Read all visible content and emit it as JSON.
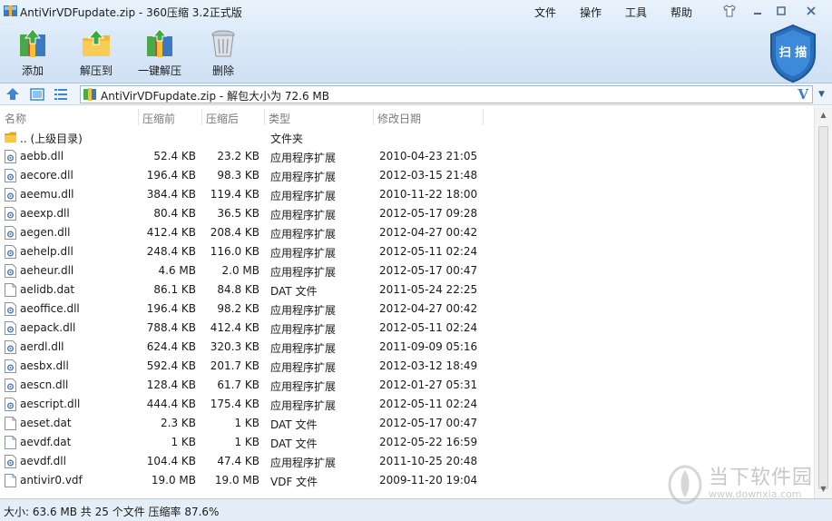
{
  "window": {
    "title": "AntiVirVDFupdate.zip - 360压缩 3.2正式版"
  },
  "menu": {
    "items": [
      "文件",
      "操作",
      "工具",
      "帮助"
    ]
  },
  "toolbar": {
    "add_label": "添加",
    "extract_label": "解压到",
    "oneclick_label": "一键解压",
    "delete_label": "删除"
  },
  "scan": {
    "label": "扫 描"
  },
  "address": {
    "path": "AntiVirVDFupdate.zip - 解包大小为 72.6 MB",
    "logo": "V"
  },
  "columns": {
    "name": "名称",
    "size": "压缩前",
    "packed": "压缩后",
    "type": "类型",
    "date": "修改日期"
  },
  "files": [
    {
      "icon": "folder-up-icon",
      "name": ".. (上级目录)",
      "size": "",
      "packed": "",
      "type": "文件夹",
      "date": ""
    },
    {
      "icon": "dll-icon",
      "name": "aebb.dll",
      "size": "52.4 KB",
      "packed": "23.2 KB",
      "type": "应用程序扩展",
      "date": "2010-04-23 21:05"
    },
    {
      "icon": "dll-icon",
      "name": "aecore.dll",
      "size": "196.4 KB",
      "packed": "98.3 KB",
      "type": "应用程序扩展",
      "date": "2012-03-15 21:48"
    },
    {
      "icon": "dll-icon",
      "name": "aeemu.dll",
      "size": "384.4 KB",
      "packed": "119.4 KB",
      "type": "应用程序扩展",
      "date": "2010-11-22 18:00"
    },
    {
      "icon": "dll-icon",
      "name": "aeexp.dll",
      "size": "80.4 KB",
      "packed": "36.5 KB",
      "type": "应用程序扩展",
      "date": "2012-05-17 09:28"
    },
    {
      "icon": "dll-icon",
      "name": "aegen.dll",
      "size": "412.4 KB",
      "packed": "208.4 KB",
      "type": "应用程序扩展",
      "date": "2012-04-27 00:42"
    },
    {
      "icon": "dll-icon",
      "name": "aehelp.dll",
      "size": "248.4 KB",
      "packed": "116.0 KB",
      "type": "应用程序扩展",
      "date": "2012-05-11 02:24"
    },
    {
      "icon": "dll-icon",
      "name": "aeheur.dll",
      "size": "4.6 MB",
      "packed": "2.0 MB",
      "type": "应用程序扩展",
      "date": "2012-05-17 00:47"
    },
    {
      "icon": "file-icon",
      "name": "aelidb.dat",
      "size": "86.1 KB",
      "packed": "84.8 KB",
      "type": "DAT 文件",
      "date": "2011-05-24 22:25"
    },
    {
      "icon": "dll-icon",
      "name": "aeoffice.dll",
      "size": "196.4 KB",
      "packed": "98.2 KB",
      "type": "应用程序扩展",
      "date": "2012-04-27 00:42"
    },
    {
      "icon": "dll-icon",
      "name": "aepack.dll",
      "size": "788.4 KB",
      "packed": "412.4 KB",
      "type": "应用程序扩展",
      "date": "2012-05-11 02:24"
    },
    {
      "icon": "dll-icon",
      "name": "aerdl.dll",
      "size": "624.4 KB",
      "packed": "320.3 KB",
      "type": "应用程序扩展",
      "date": "2011-09-09 05:16"
    },
    {
      "icon": "dll-icon",
      "name": "aesbx.dll",
      "size": "592.4 KB",
      "packed": "201.7 KB",
      "type": "应用程序扩展",
      "date": "2012-03-12 18:49"
    },
    {
      "icon": "dll-icon",
      "name": "aescn.dll",
      "size": "128.4 KB",
      "packed": "61.7 KB",
      "type": "应用程序扩展",
      "date": "2012-01-27 05:31"
    },
    {
      "icon": "dll-icon",
      "name": "aescript.dll",
      "size": "444.4 KB",
      "packed": "175.4 KB",
      "type": "应用程序扩展",
      "date": "2012-05-11 02:24"
    },
    {
      "icon": "file-icon",
      "name": "aeset.dat",
      "size": "2.3 KB",
      "packed": "1 KB",
      "type": "DAT 文件",
      "date": "2012-05-17 00:47"
    },
    {
      "icon": "file-icon",
      "name": "aevdf.dat",
      "size": "1 KB",
      "packed": "1 KB",
      "type": "DAT 文件",
      "date": "2012-05-22 16:59"
    },
    {
      "icon": "dll-icon",
      "name": "aevdf.dll",
      "size": "104.4 KB",
      "packed": "47.4 KB",
      "type": "应用程序扩展",
      "date": "2011-10-25 20:48"
    },
    {
      "icon": "file-icon",
      "name": "antivir0.vdf",
      "size": "19.0 MB",
      "packed": "19.0 MB",
      "type": "VDF 文件",
      "date": "2009-11-20 19:04"
    }
  ],
  "status": {
    "text": "大小: 63.6 MB 共 25 个文件 压缩率 87.6%"
  },
  "watermark": {
    "text": "当下软件园",
    "url": "www.downxia.com"
  },
  "colors": {
    "accent": "#2f78c4",
    "toolbar_bg": "#dbe9f8",
    "status_bg": "#e4eef8"
  }
}
